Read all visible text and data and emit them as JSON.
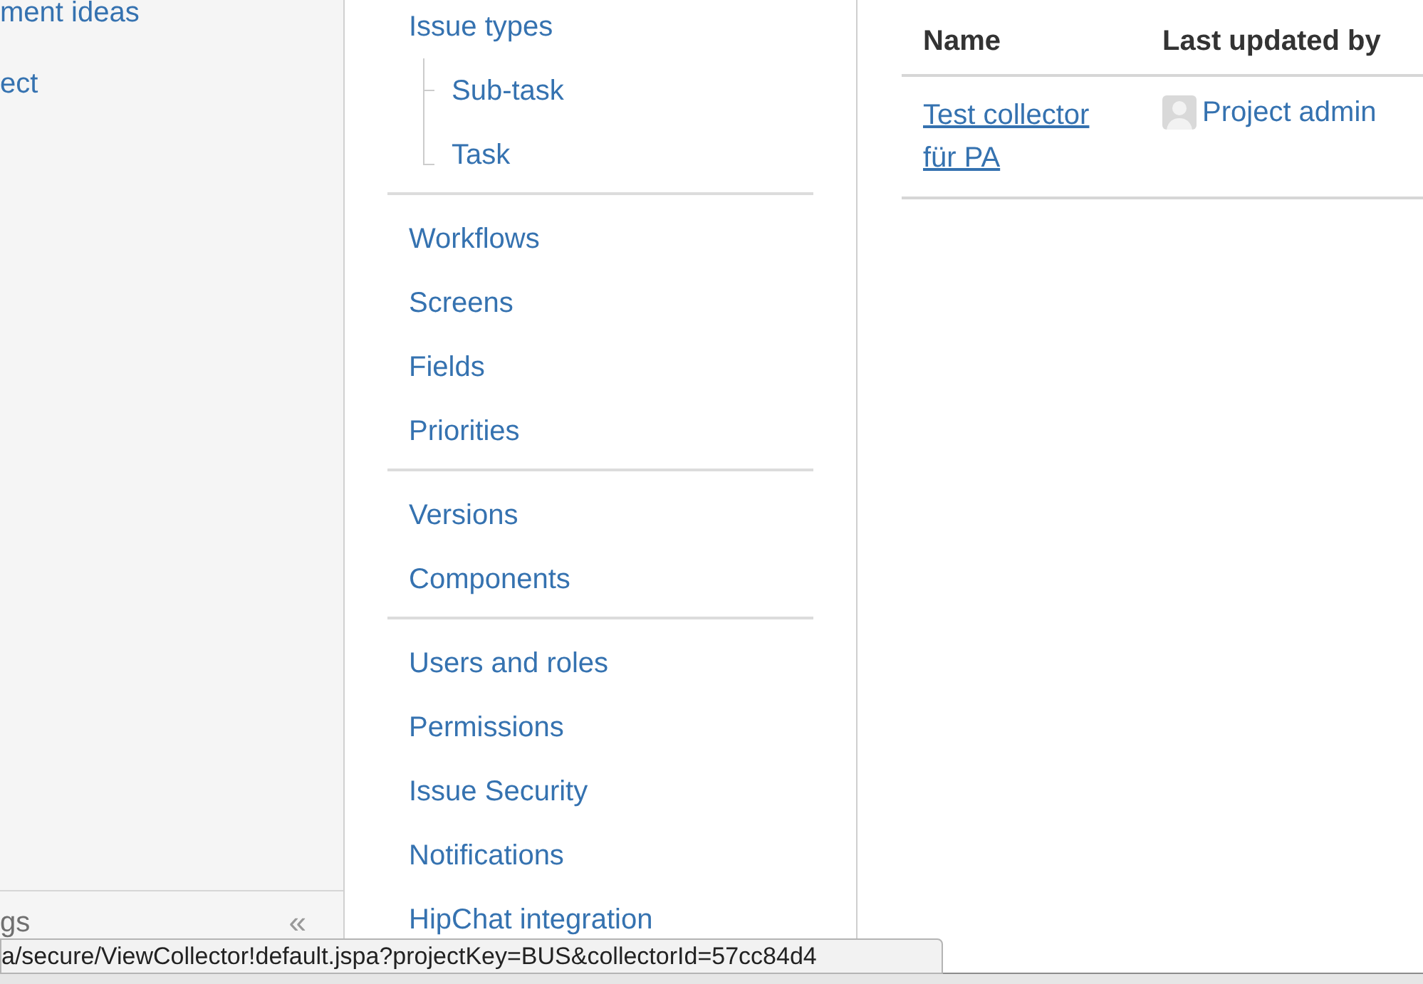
{
  "sidebar": {
    "items": [
      {
        "label": "ment ideas"
      },
      {
        "label": "ect"
      }
    ],
    "footer": {
      "label": "gs",
      "collapse": "«"
    }
  },
  "nav": {
    "sections": [
      {
        "items": [
          {
            "label": "Issue types",
            "children": [
              {
                "label": "Sub-task"
              },
              {
                "label": "Task"
              }
            ]
          }
        ]
      },
      {
        "items": [
          {
            "label": "Workflows"
          },
          {
            "label": "Screens"
          },
          {
            "label": "Fields"
          },
          {
            "label": "Priorities"
          }
        ]
      },
      {
        "items": [
          {
            "label": "Versions"
          },
          {
            "label": "Components"
          }
        ]
      },
      {
        "items": [
          {
            "label": "Users and roles"
          },
          {
            "label": "Permissions"
          },
          {
            "label": "Issue Security"
          },
          {
            "label": "Notifications"
          },
          {
            "label": "HipChat integration"
          }
        ]
      }
    ]
  },
  "table": {
    "columns": [
      "Name",
      "Last updated by"
    ],
    "rows": [
      {
        "name": "Test collector für PA",
        "updated_by": "Project admin"
      }
    ]
  },
  "status_url": "a/secure/ViewCollector!default.jspa?projectKey=BUS&collectorId=57cc84d4"
}
